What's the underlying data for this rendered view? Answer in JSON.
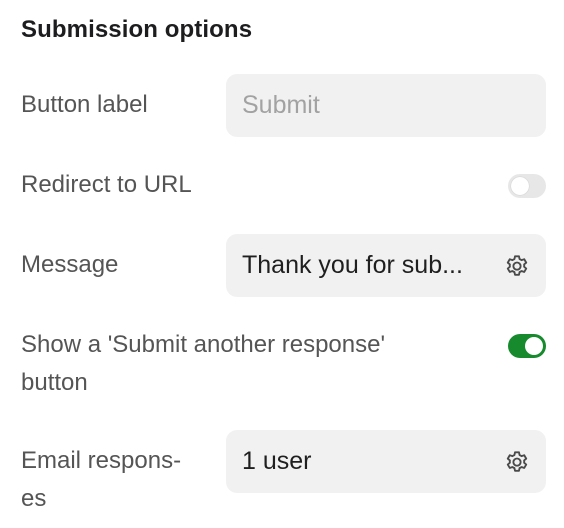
{
  "section": {
    "title": "Submission options"
  },
  "rows": {
    "button_label": {
      "label": "Button label",
      "placeholder": "Submit"
    },
    "redirect": {
      "label": "Redirect to URL",
      "toggle": "off"
    },
    "message": {
      "label": "Message",
      "value": "Thank you for sub...",
      "icon": "gear-icon"
    },
    "submit_another": {
      "label_line1": "Show a 'Submit another response'",
      "label_line2": "button",
      "toggle": "on"
    },
    "email": {
      "label_line1": "Email respons-",
      "label_line2": "es",
      "value": "1 user",
      "icon": "gear-icon"
    }
  },
  "colors": {
    "toggle_on": "#178a2e",
    "toggle_off": "#e7e7e7",
    "field_bg": "#f1f1f1"
  }
}
